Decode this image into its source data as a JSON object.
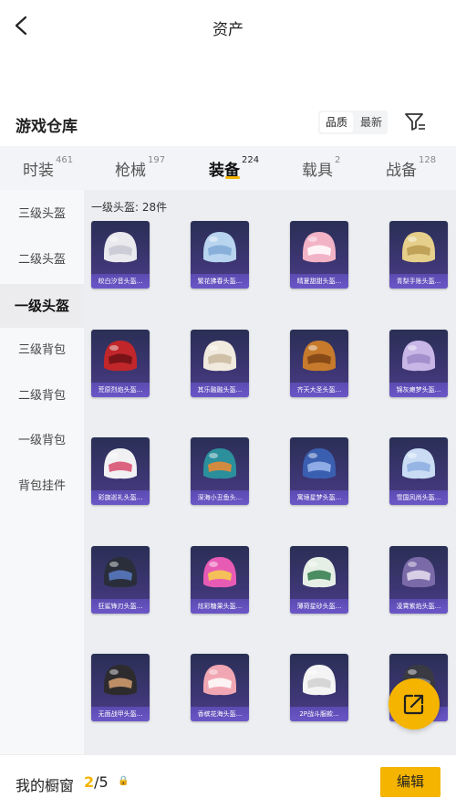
{
  "header": {
    "title": "资产"
  },
  "section": {
    "title": "游戏仓库",
    "sort_options": [
      "品质",
      "最新"
    ],
    "sort_active": "品质"
  },
  "tabs": [
    {
      "label": "时装",
      "count": "461"
    },
    {
      "label": "枪械",
      "count": "197"
    },
    {
      "label": "装备",
      "count": "224",
      "active": true
    },
    {
      "label": "载具",
      "count": "2"
    },
    {
      "label": "战备",
      "count": "128"
    }
  ],
  "sidebar": {
    "items": [
      {
        "label": "三级头盔"
      },
      {
        "label": "二级头盔"
      },
      {
        "label": "一级头盔",
        "active": true
      },
      {
        "label": "三级背包"
      },
      {
        "label": "二级背包"
      },
      {
        "label": "一级背包"
      },
      {
        "label": "背包挂件"
      }
    ]
  },
  "content": {
    "count_label": "一级头盔: 28件",
    "items": [
      {
        "name": "皎白汐音头盔...",
        "color": "#e9e9ee",
        "accent": "#c8c8d2"
      },
      {
        "name": "繁花拂春头盔...",
        "color": "#b8d4ee",
        "accent": "#7fa9d6"
      },
      {
        "name": "晴夏甜甜头盔...",
        "color": "#f3b3c6",
        "accent": "#ffffff"
      },
      {
        "name": "青梨手账头盔...",
        "color": "#e6cf8a",
        "accent": "#b89a50"
      },
      {
        "name": "荒原烈焰头盔...",
        "color": "#c0262a",
        "accent": "#6b1014"
      },
      {
        "name": "其乐融融头盔...",
        "color": "#f1eadf",
        "accent": "#c9b99d"
      },
      {
        "name": "齐天大圣头盔...",
        "color": "#c77a2c",
        "accent": "#7d4314"
      },
      {
        "name": "锦灰瘫梦头盔...",
        "color": "#c7b6e6",
        "accent": "#9d88c8"
      },
      {
        "name": "彩旗巡礼头盔...",
        "color": "#f1f1f4",
        "accent": "#d84a6a"
      },
      {
        "name": "深海小丑鱼头...",
        "color": "#2b8f9c",
        "accent": "#f08a30"
      },
      {
        "name": "寓境星梦头盔...",
        "color": "#3a5fb0",
        "accent": "#9db8ee"
      },
      {
        "name": "雪国风尚头盔...",
        "color": "#c9dcf4",
        "accent": "#8eaee0"
      },
      {
        "name": "狂鲨锋刃头盔...",
        "color": "#2a2e3a",
        "accent": "#5a7cc8"
      },
      {
        "name": "炫彩糖果头盔...",
        "color": "#e85bb5",
        "accent": "#f7d24a"
      },
      {
        "name": "薄荷星砂头盔...",
        "color": "#e6efe6",
        "accent": "#2f7a4a"
      },
      {
        "name": "凌霄紫焰头盔...",
        "color": "#7a6aa8",
        "accent": "#e6e0f0"
      },
      {
        "name": "无面战甲头盔...",
        "color": "#2d2b2e",
        "accent": "#d7a070"
      },
      {
        "name": "香槟花海头盔...",
        "color": "#f1a7b3",
        "accent": "#ffffff"
      },
      {
        "name": "2P战斗服款...",
        "color": "#f4f4f4",
        "accent": "#d0d0d0"
      },
      {
        "name": "",
        "color": "#3a3a42",
        "accent": "#8d8d96"
      }
    ]
  },
  "bottom": {
    "showcase_label": "我的橱窗",
    "showcase_current": "2",
    "showcase_total": "/5",
    "lock_glyph": "🔒",
    "edit_label": "编辑"
  },
  "colors": {
    "accent": "#f5b400",
    "card_bg": "#3b3570",
    "card_label": "#6c56c8"
  }
}
